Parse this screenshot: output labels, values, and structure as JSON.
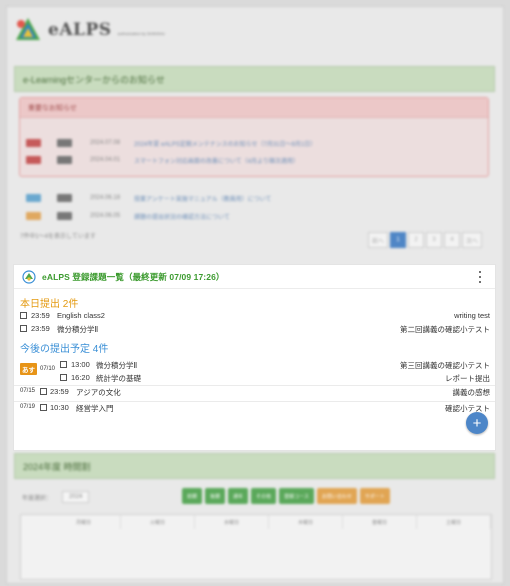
{
  "logo": {
    "name": "eALPS",
    "subtitle": "authorization by SHINSHU"
  },
  "news": {
    "header": "e-Learningセンターからのお知らせ",
    "important_title": "重要なお知らせ",
    "important_items": [
      {
        "date": "2024.07.08",
        "text": "2024年夏 eALPS定期メンテナンスのお知らせ（7月31日〜8月1日）"
      },
      {
        "date": "2024.04.01",
        "text": "スマートフォン対応画面の改善について（4月より順次適用）"
      }
    ],
    "items": [
      {
        "date": "2024.06.18",
        "text": "授業アンケート実施マニュアル（教員用）について"
      },
      {
        "date": "2024.06.05",
        "text": "課題の提出状況の確認方法について"
      }
    ],
    "count_text": "7件中1〜4を表示しています",
    "pager": [
      "前へ",
      "1",
      "2",
      "3",
      "4",
      "次へ"
    ]
  },
  "dialog": {
    "title": "eALPS 登録課題一覧（最終更新 07/09 17:26）",
    "today_header": "本日提出 2件",
    "today": [
      {
        "time": "23:59",
        "name": "English class2",
        "detail": "writing test"
      },
      {
        "time": "23:59",
        "name": "微分積分学Ⅱ",
        "detail": "第二回講義の確認小テスト"
      }
    ],
    "future_header": "今後の提出予定 4件",
    "tomorrow_badge": "あす",
    "future_groups": [
      {
        "date": "07/10",
        "items": [
          {
            "time": "13:00",
            "name": "微分積分学Ⅱ",
            "detail": "第三回講義の確認小テスト"
          },
          {
            "time": "16:20",
            "name": "統計学の基礎",
            "detail": "レポート提出"
          }
        ]
      },
      {
        "date": "07/15",
        "items": [
          {
            "time": "23:59",
            "name": "アジアの文化",
            "detail": "講義の感想"
          }
        ]
      },
      {
        "date": "07/19",
        "items": [
          {
            "time": "10:30",
            "name": "経営学入門",
            "detail": "確認小テスト"
          }
        ]
      }
    ],
    "fab": "+"
  },
  "schedule": {
    "header": "2024年度 時間割",
    "year_label": "年度選択：",
    "year_value": "2024",
    "buttons": [
      "前期",
      "後期",
      "通年",
      "その他",
      "登録コース"
    ],
    "buttons_orange": [
      "お問い合わせ",
      "サポート"
    ],
    "days": [
      "月曜日",
      "火曜日",
      "水曜日",
      "木曜日",
      "金曜日",
      "土曜日"
    ]
  }
}
